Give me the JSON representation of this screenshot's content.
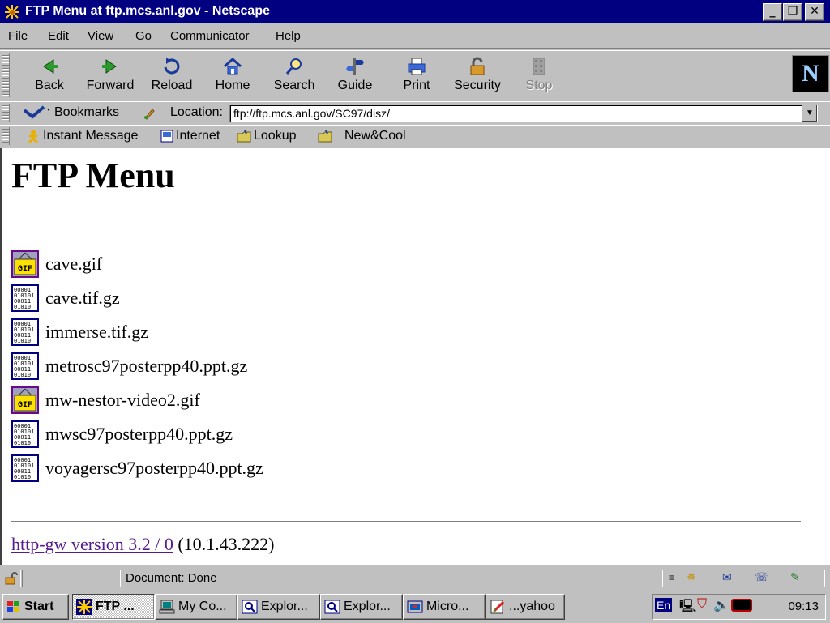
{
  "window": {
    "title": "FTP Menu at ftp.mcs.anl.gov - Netscape"
  },
  "menu": [
    "File",
    "Edit",
    "View",
    "Go",
    "Communicator",
    "Help"
  ],
  "toolbar": {
    "back": "Back",
    "forward": "Forward",
    "reload": "Reload",
    "home": "Home",
    "search": "Search",
    "guide": "Guide",
    "print": "Print",
    "security": "Security",
    "stop": "Stop"
  },
  "location": {
    "bookmarks_label": "Bookmarks",
    "location_label": "Location:",
    "url": "ftp://ftp.mcs.anl.gov/SC97/disz/"
  },
  "personal": [
    "Instant Message",
    "Internet",
    "Lookup",
    "New&Cool"
  ],
  "page": {
    "heading": "FTP Menu",
    "files": [
      {
        "name": "cave.gif",
        "icon": "gif-icon"
      },
      {
        "name": "cave.tif.gz",
        "icon": "binary-icon"
      },
      {
        "name": "immerse.tif.gz",
        "icon": "binary-icon"
      },
      {
        "name": "metrosc97posterpp40.ppt.gz",
        "icon": "binary-icon"
      },
      {
        "name": "mw-nestor-video2.gif",
        "icon": "gif-icon"
      },
      {
        "name": "mwsc97posterpp40.ppt.gz",
        "icon": "binary-icon"
      },
      {
        "name": "voyagersc97posterpp40.ppt.gz",
        "icon": "binary-icon"
      }
    ],
    "footer_link": "http-gw version 3.2 / 0",
    "footer_ip": "(10.1.43.222)"
  },
  "status": {
    "text": "Document: Done"
  },
  "taskbar": {
    "start": "Start",
    "buttons": [
      "FTP ...",
      "My Co...",
      "Explor...",
      "Explor...",
      "Micro...",
      "...yahoo"
    ],
    "lang": "En",
    "clock": "09:13"
  },
  "colors": {
    "titlebar": "#000080",
    "link_visited": "#551a8b",
    "chrome": "#c0c0c0"
  }
}
